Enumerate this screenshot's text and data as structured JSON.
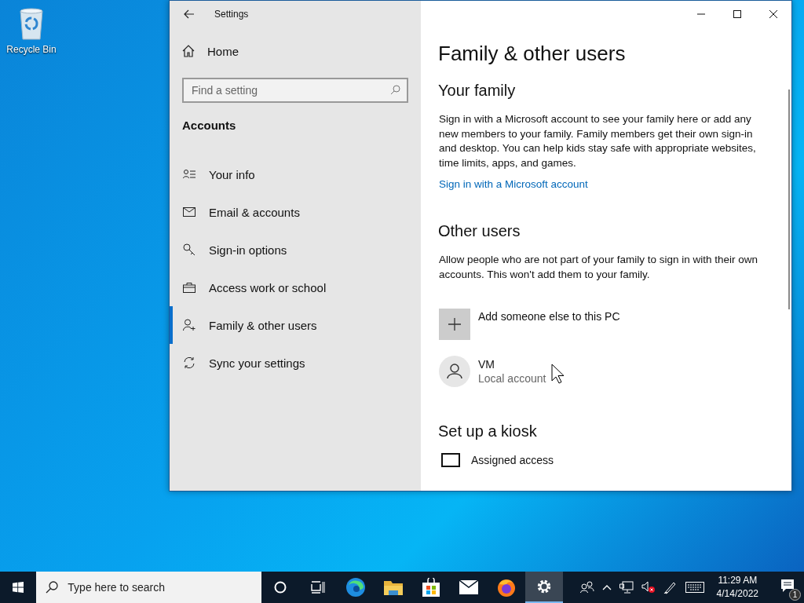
{
  "desktop_icons": [
    {
      "label": "Recycle Bin"
    }
  ],
  "window": {
    "title": "Settings",
    "home": "Home",
    "search": {
      "placeholder": "Find a setting"
    },
    "section": "Accounts",
    "nav_items": [
      {
        "label": "Your info",
        "selected": false
      },
      {
        "label": "Email & accounts",
        "selected": false
      },
      {
        "label": "Sign-in options",
        "selected": false
      },
      {
        "label": "Access work or school",
        "selected": false
      },
      {
        "label": "Family & other users",
        "selected": true
      },
      {
        "label": "Sync your settings",
        "selected": false
      }
    ],
    "page": {
      "title": "Family & other users",
      "your_family": {
        "heading": "Your family",
        "text": "Sign in with a Microsoft account to see your family here or add any new members to your family. Family members get their own sign-in and desktop. You can help kids stay safe with appropriate websites, time limits, apps, and games.",
        "link": "Sign in with a Microsoft account"
      },
      "other_users": {
        "heading": "Other users",
        "text": "Allow people who are not part of your family to sign in with their own accounts. This won't add them to your family.",
        "add_button": "Add someone else to this PC",
        "users": [
          {
            "name": "VM",
            "subtitle": "Local account"
          }
        ]
      },
      "kiosk": {
        "heading": "Set up a kiosk",
        "item": "Assigned access"
      }
    }
  },
  "taskbar": {
    "search": {
      "placeholder": "Type here to search"
    },
    "apps": [
      {
        "kind": "cortana",
        "selected": false
      },
      {
        "kind": "taskview",
        "selected": false
      },
      {
        "kind": "edge",
        "selected": false
      },
      {
        "kind": "explorer",
        "selected": false
      },
      {
        "kind": "store",
        "selected": false
      },
      {
        "kind": "mail",
        "selected": false
      },
      {
        "kind": "firefox",
        "selected": false
      },
      {
        "kind": "settings",
        "selected": true
      }
    ],
    "time": "11:29 AM",
    "date": "4/14/2022",
    "notification_count": "1"
  }
}
